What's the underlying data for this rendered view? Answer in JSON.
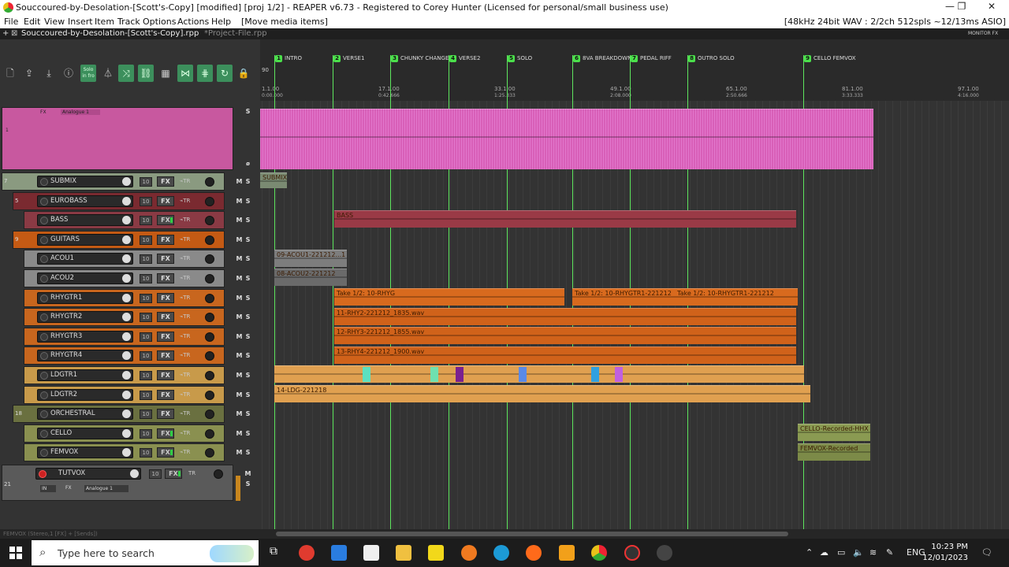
{
  "window": {
    "title": "Souccoured-by-Desolation-[Scott's-Copy] [modified] [proj 1/2] - REAPER v6.73 - Registered to Corey Hunter (Licensed for personal/small business use)",
    "minimize": "—",
    "maximize": "❐",
    "close": "✕"
  },
  "menu": {
    "items": [
      "File",
      "Edit",
      "View",
      "Insert",
      "Item",
      "Track",
      "Options",
      "Actions",
      "Help",
      "[Move media items]"
    ],
    "status": "[48kHz 24bit WAV : 2/2ch 512spls ~12/13ms ASIO]"
  },
  "tabs": {
    "add": "+",
    "active": "Souccoured-by-Desolation-[Scott's-Copy].rpp",
    "inactive": "*Project-File.rpp",
    "monitor_fx": "MONITOR FX"
  },
  "master": {
    "fx_label": "FX",
    "plugin": "Analogue 1",
    "s": "S",
    "num": "1"
  },
  "tracks": [
    {
      "num": "7",
      "name": "SUBMIX",
      "color": "#8a9a80",
      "indent": 0,
      "fx": "FX",
      "active_fx": false
    },
    {
      "num": "5",
      "name": "EUROBASS",
      "color": "#7a2a30",
      "indent": 1,
      "fx": "FX",
      "active_fx": false
    },
    {
      "num": "",
      "name": "BASS",
      "color": "#8a3a44",
      "indent": 2,
      "fx": "FX",
      "active_fx": true
    },
    {
      "num": "9",
      "name": "GUITARS",
      "color": "#c45a14",
      "indent": 1,
      "fx": "FX",
      "active_fx": false
    },
    {
      "num": "",
      "name": "ACOU1",
      "color": "#8a8a8a",
      "indent": 2,
      "fx": "FX",
      "active_fx": false
    },
    {
      "num": "",
      "name": "ACOU2",
      "color": "#8a8a8a",
      "indent": 2,
      "fx": "FX",
      "active_fx": false
    },
    {
      "num": "",
      "name": "RHYGTR1",
      "color": "#c8661e",
      "indent": 2,
      "fx": "FX",
      "active_fx": false
    },
    {
      "num": "",
      "name": "RHYGTR2",
      "color": "#c8661e",
      "indent": 2,
      "fx": "FX",
      "active_fx": false
    },
    {
      "num": "",
      "name": "RHYGTR3",
      "color": "#c8661e",
      "indent": 2,
      "fx": "FX",
      "active_fx": false
    },
    {
      "num": "",
      "name": "RHYGTR4",
      "color": "#c8661e",
      "indent": 2,
      "fx": "FX",
      "active_fx": false
    },
    {
      "num": "",
      "name": "LDGTR1",
      "color": "#c89a4a",
      "indent": 2,
      "fx": "FX",
      "active_fx": false
    },
    {
      "num": "",
      "name": "LDGTR2",
      "color": "#c89a4a",
      "indent": 2,
      "fx": "FX",
      "active_fx": false
    },
    {
      "num": "18",
      "name": "ORCHESTRAL",
      "color": "#6a7040",
      "indent": 1,
      "fx": "FX",
      "active_fx": false
    },
    {
      "num": "",
      "name": "CELLO",
      "color": "#8a9050",
      "indent": 2,
      "fx": "FX",
      "active_fx": true
    },
    {
      "num": "",
      "name": "FEMVOX",
      "color": "#8a9050",
      "indent": 2,
      "fx": "FX",
      "active_fx": true
    }
  ],
  "tutvox": {
    "num": "21",
    "name": "TUTVOX",
    "io": "10",
    "fx": "FX",
    "tr": "TR",
    "in_label": "IN",
    "fx_label": "FX",
    "plugin": "Analogue 1",
    "m": "M",
    "s": "S"
  },
  "track_controls": {
    "io": "10",
    "tr": "⌁TR",
    "m": "M",
    "s": "S"
  },
  "markers": [
    {
      "n": "1",
      "label": "INTRO"
    },
    {
      "n": "2",
      "label": "VERSE1"
    },
    {
      "n": "3",
      "label": "CHUNKY CHANGE"
    },
    {
      "n": "4",
      "label": "VERSE2"
    },
    {
      "n": "5",
      "label": "SOLO"
    },
    {
      "n": "6",
      "label": "8VA BREAKDOWN"
    },
    {
      "n": "7",
      "label": "PEDAL RIFF"
    },
    {
      "n": "8",
      "label": "OUTRO SOLO"
    },
    {
      "n": "9",
      "label": "CELLO FEMVOX"
    }
  ],
  "ruler": {
    "tempo": "90",
    "bars": [
      {
        "bar": "1.1.00",
        "time": "0:00.000"
      },
      {
        "bar": "17.1.00",
        "time": "0:42.666"
      },
      {
        "bar": "33.1.00",
        "time": "1:25.333"
      },
      {
        "bar": "49.1.00",
        "time": "2:08.000"
      },
      {
        "bar": "65.1.00",
        "time": "2:50.666"
      },
      {
        "bar": "81.1.00",
        "time": "3:33.333"
      },
      {
        "bar": "97.1.00",
        "time": "4:16.000"
      }
    ]
  },
  "items": {
    "submix": "SUBMIX",
    "bass": "BASS",
    "acou1": "09-ACOU1-221212...1",
    "acou2": "08-ACOU2-221212",
    "rhy1a": "Take 1/2: 10-RHYG",
    "rhy1b": "Take 1/2: 10-RHYGTR1-221212",
    "rhy1c": "Take 1/2: 10-RHYGTR1-221212",
    "rhy2": "11-RHY2-221212_1835.wav",
    "rhy3": "12-RHY3-221212_1855.wav",
    "rhy4": "13-RHY4-221212_1900.wav",
    "ld2": "14-LDG-221218",
    "cello": "CELLO-Recorded-HHX",
    "femvox": "FEMVOX-Recorded"
  },
  "statusline": "FEMVOX (Stereo,1 [FX] + [Sends])",
  "taskbar": {
    "search_placeholder": "Type here to search",
    "lang": "ENG",
    "time": "10:23 PM",
    "date": "12/01/2023"
  },
  "colors": {
    "marker": "#5ee65e",
    "master_item": "#e070c8",
    "rhythm": "#d86a1e",
    "lead": "#e0a050"
  }
}
